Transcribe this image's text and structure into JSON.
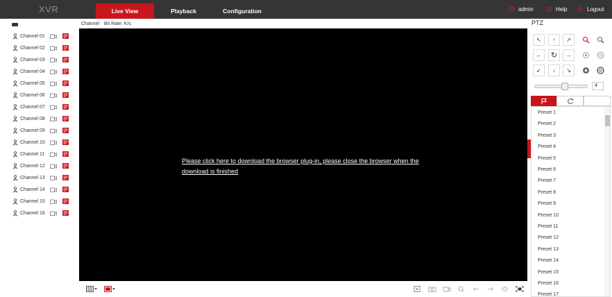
{
  "topbar": {
    "logo": "XVR",
    "nav": [
      {
        "label": "Live View",
        "active": true
      },
      {
        "label": "Playback",
        "active": false
      },
      {
        "label": "Configuration",
        "active": false
      }
    ],
    "user": "admin",
    "help": "Help",
    "logout": "Logout"
  },
  "channels": [
    "Channel 01",
    "Channel 02",
    "Channel 03",
    "Channel 04",
    "Channel 05",
    "Channel 06",
    "Channel 07",
    "Channel 08",
    "Channel 09",
    "Channel 10",
    "Channel 11",
    "Channel 12",
    "Channel 13",
    "Channel 14",
    "Channel 15",
    "Channel 16"
  ],
  "main": {
    "channel_label": "Channel",
    "bitrate_label": "Bit Rate: K/s",
    "plugin_message": "Please click here to download the browser plug-in, please close the browser when the download is finished"
  },
  "ptz": {
    "title": "PTZ",
    "speed": "4",
    "presets": [
      "Preset 1",
      "Preset 2",
      "Preset 3",
      "Preset 4",
      "Preset 5",
      "Preset 6",
      "Preset 7",
      "Preset 8",
      "Preset 9",
      "Preset 10",
      "Preset 11",
      "Preset 12",
      "Preset 13",
      "Preset 14",
      "Preset 15",
      "Preset 16",
      "Preset 17"
    ]
  },
  "colors": {
    "accent": "#c8161d",
    "topbar": "#353535",
    "video_bg": "#000000"
  }
}
